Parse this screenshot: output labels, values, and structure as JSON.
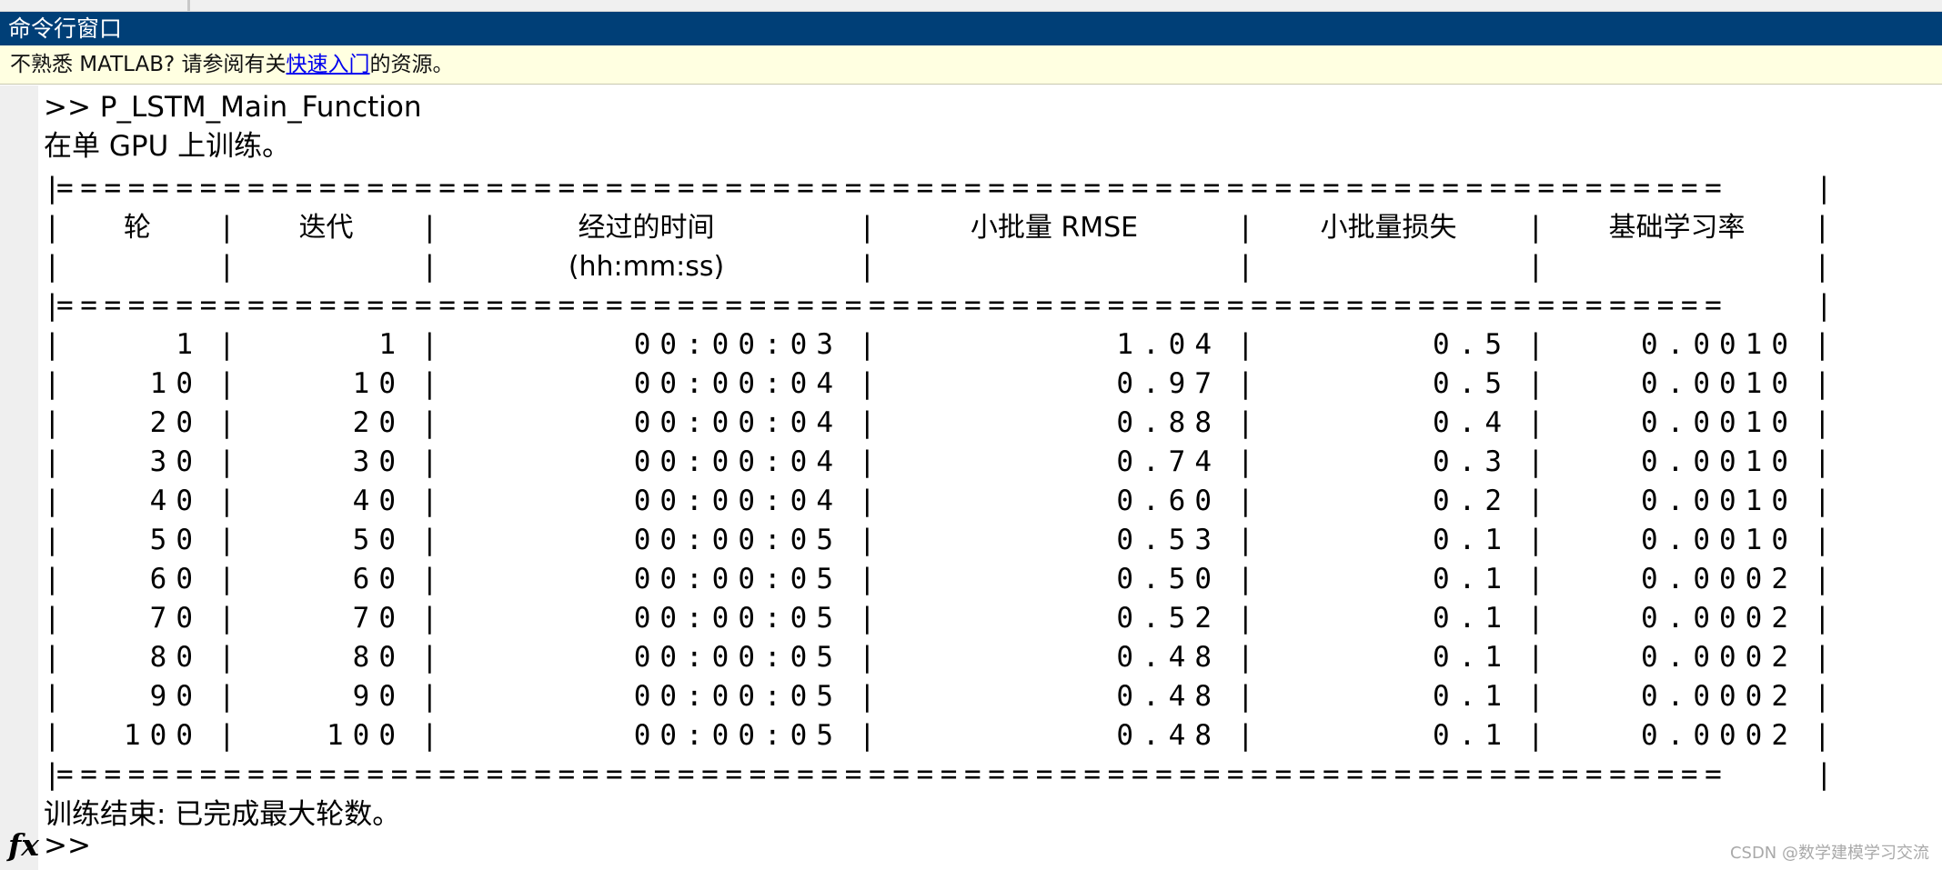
{
  "window": {
    "title": "命令行窗口"
  },
  "banner": {
    "prefix": "不熟悉 MATLAB? 请参阅有关",
    "link": "快速入门",
    "suffix": "的资源。"
  },
  "console": {
    "command": ">> P_LSTM_Main_Function",
    "info": "在单 GPU 上训练。",
    "rule_char": "=",
    "columns": [
      {
        "line1": "轮",
        "line2": ""
      },
      {
        "line1": "迭代",
        "line2": ""
      },
      {
        "line1": "经过的时间",
        "line2": "(hh:mm:ss)"
      },
      {
        "line1": "小批量 RMSE",
        "line2": ""
      },
      {
        "line1": "小批量损失",
        "line2": ""
      },
      {
        "line1": "基础学习率",
        "line2": ""
      }
    ],
    "rows": [
      [
        "1",
        "1",
        "00:00:03",
        "1.04",
        "0.5",
        "0.0010"
      ],
      [
        "10",
        "10",
        "00:00:04",
        "0.97",
        "0.5",
        "0.0010"
      ],
      [
        "20",
        "20",
        "00:00:04",
        "0.88",
        "0.4",
        "0.0010"
      ],
      [
        "30",
        "30",
        "00:00:04",
        "0.74",
        "0.3",
        "0.0010"
      ],
      [
        "40",
        "40",
        "00:00:04",
        "0.60",
        "0.2",
        "0.0010"
      ],
      [
        "50",
        "50",
        "00:00:05",
        "0.53",
        "0.1",
        "0.0010"
      ],
      [
        "60",
        "60",
        "00:00:05",
        "0.50",
        "0.1",
        "0.0002"
      ],
      [
        "70",
        "70",
        "00:00:05",
        "0.52",
        "0.1",
        "0.0002"
      ],
      [
        "80",
        "80",
        "00:00:05",
        "0.48",
        "0.1",
        "0.0002"
      ],
      [
        "90",
        "90",
        "00:00:05",
        "0.48",
        "0.1",
        "0.0002"
      ],
      [
        "100",
        "100",
        "00:00:05",
        "0.48",
        "0.1",
        "0.0002"
      ]
    ],
    "end_message": "训练结束: 已完成最大轮数。",
    "prompt": ">>"
  },
  "icons": {
    "function_browser": "fx-icon"
  },
  "watermark": "CSDN @数学建模学习交流",
  "colors": {
    "title_bar": "#003f77",
    "banner_bg": "#ffffe1",
    "link": "#0000ee"
  }
}
